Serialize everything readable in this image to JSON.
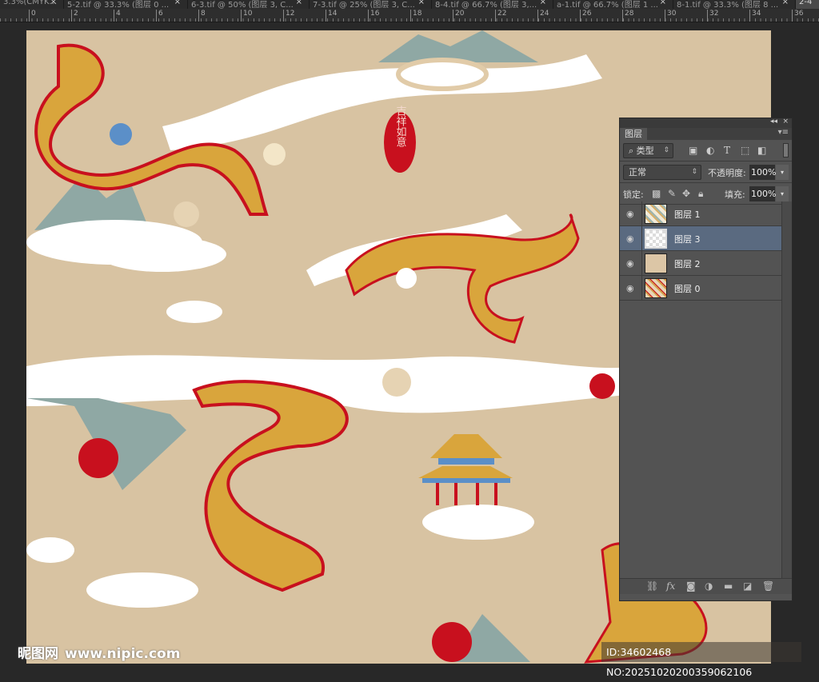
{
  "tabs": [
    {
      "label": "3.3%(CMYK..."
    },
    {
      "label": "5-2.tif @ 33.3% (图层 0 ..."
    },
    {
      "label": "6-3.tif @ 50% (图层 3, C..."
    },
    {
      "label": "7-3.tif @ 25% (图层 3, C..."
    },
    {
      "label": "8-4.tif @ 66.7% (图层 3,..."
    },
    {
      "label": "a-1.tif @ 66.7% (图层 1 ..."
    },
    {
      "label": "8-1.tif @ 33.3% (图层 8 ..."
    },
    {
      "label": "2-4"
    }
  ],
  "tab_close": "×",
  "ruler": [
    "0",
    "2",
    "4",
    "6",
    "8",
    "10",
    "12",
    "14",
    "16",
    "18",
    "20",
    "22",
    "24",
    "26",
    "28",
    "30",
    "32",
    "34",
    "36"
  ],
  "artwork": {
    "seal_text": "吉祥如意"
  },
  "panel": {
    "collapse": "◂◂",
    "close": "×",
    "tab": "图层",
    "menu": "▾≡",
    "filter": "类型",
    "filter_icon": "⌕",
    "blend_mode": "正常",
    "opacity_label": "不透明度:",
    "opacity": "100%",
    "lock_label": "锁定:",
    "fill_label": "填充:",
    "fill": "100%",
    "layers": [
      {
        "name": "图层 1",
        "selected": false,
        "thumb": "pattern"
      },
      {
        "name": "图层 3",
        "selected": true,
        "thumb": "transparent"
      },
      {
        "name": "图层 2",
        "selected": false,
        "thumb": "#dcc6a6"
      },
      {
        "name": "图层 0",
        "selected": false,
        "thumb": "pattern"
      }
    ]
  },
  "watermark": {
    "site": "昵图网",
    "url": "www.nipic.com",
    "id": "ID:34602468 NO:20251020200359062106"
  },
  "colors": {
    "canvas_bg": "#d8c3a2",
    "gold": "#d9a53c",
    "red": "#c8101e",
    "teal": "#8fa8a4",
    "selected_layer": "#5a6a80"
  }
}
